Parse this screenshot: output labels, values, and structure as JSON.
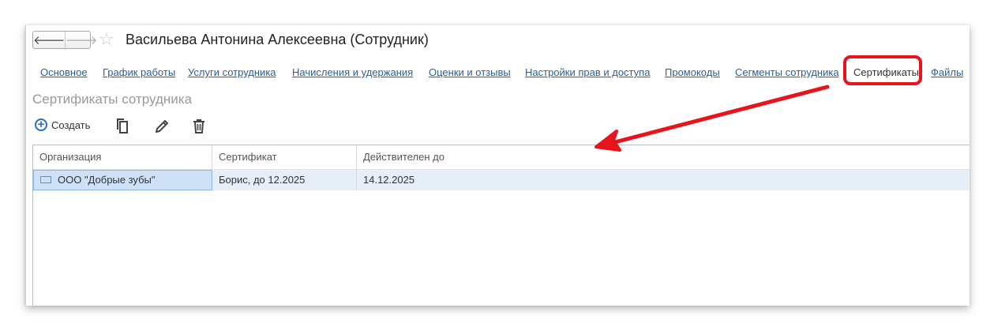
{
  "window": {
    "title": "Васильева Антонина Алексеевна (Сотрудник)",
    "back_glyph": "🡐",
    "forward_glyph": "🡒",
    "favorite_glyph": "☆"
  },
  "tabs": [
    {
      "label": "Основное"
    },
    {
      "label": "График работы"
    },
    {
      "label": "Услуги сотрудника"
    },
    {
      "label": "Начисления и удержания"
    },
    {
      "label": "Оценки и отзывы"
    },
    {
      "label": "Настройки прав и доступа"
    },
    {
      "label": "Промокоды"
    },
    {
      "label": "Сегменты сотрудника"
    },
    {
      "label": "Сертификаты",
      "active": true
    },
    {
      "label": "Файлы"
    }
  ],
  "section": {
    "title": "Сертификаты сотрудника"
  },
  "toolbar": {
    "create_label": "Создать"
  },
  "table": {
    "columns": [
      "Организация",
      "Сертификат",
      "Действителен до"
    ],
    "rows": [
      {
        "organization": "ООО \"Добрые зубы\"",
        "certificate": "Борис, до 12.2025",
        "valid_until": "14.12.2025"
      }
    ]
  },
  "colors": {
    "accent": "#2a6cc7",
    "link": "#2b5d9e",
    "annotation": "#e8141c",
    "row_selected": "#e6eef8"
  }
}
